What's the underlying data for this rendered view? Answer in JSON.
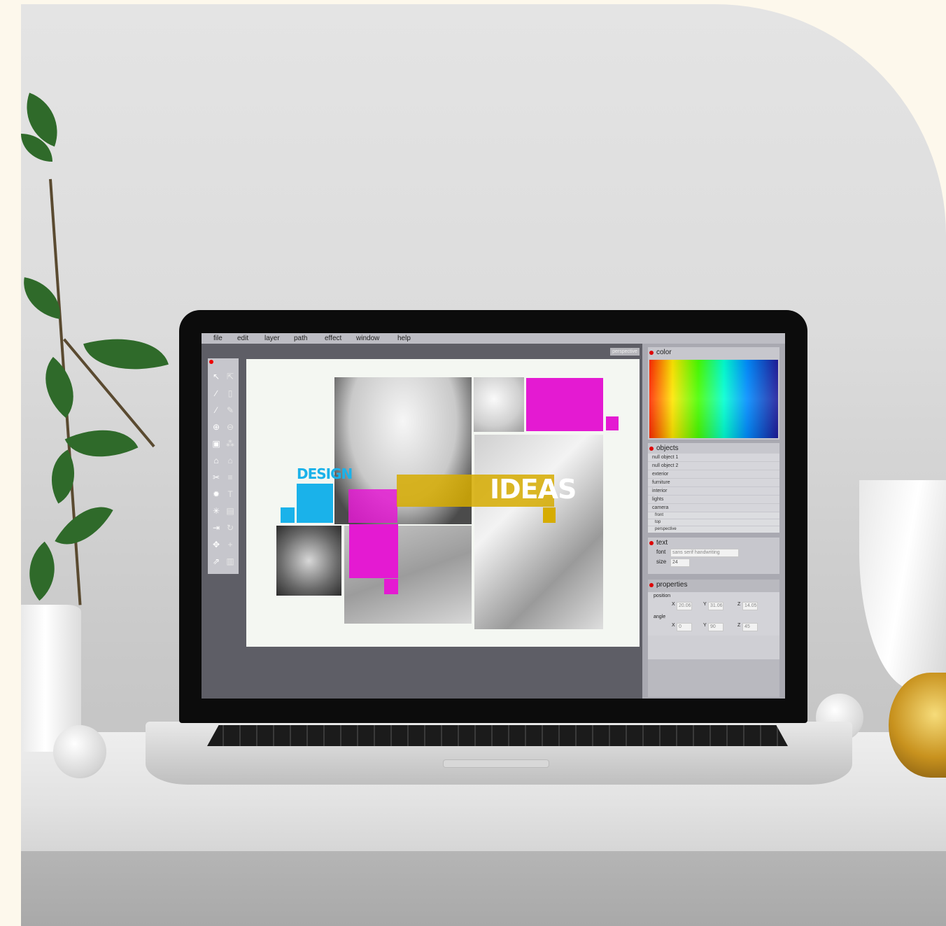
{
  "app": {
    "menu": [
      "file",
      "edit",
      "layer",
      "path",
      "effect",
      "window",
      "help"
    ],
    "view_tab": "perspective",
    "tools": [
      {
        "icon": "select-arrow-icon",
        "glyph": "↖"
      },
      {
        "icon": "direct-select-icon",
        "glyph": "⇱"
      },
      {
        "icon": "brush-icon",
        "glyph": "∕"
      },
      {
        "icon": "new-page-icon",
        "glyph": "▯"
      },
      {
        "icon": "eyedropper-icon",
        "glyph": "⁄"
      },
      {
        "icon": "pencil-icon",
        "glyph": "✎"
      },
      {
        "icon": "zoom-in-icon",
        "glyph": "⊕"
      },
      {
        "icon": "zoom-out-icon",
        "glyph": "⊖"
      },
      {
        "icon": "lock-icon",
        "glyph": "▣"
      },
      {
        "icon": "magic-wand-icon",
        "glyph": "⁂"
      },
      {
        "icon": "home-icon",
        "glyph": "⌂"
      },
      {
        "icon": "home-filled-icon",
        "glyph": "⌂"
      },
      {
        "icon": "scissors-icon",
        "glyph": "✂"
      },
      {
        "icon": "layers-icon",
        "glyph": "≡"
      },
      {
        "icon": "gear-icon",
        "glyph": "✹"
      },
      {
        "icon": "text-icon",
        "glyph": "T"
      },
      {
        "icon": "sparkle-icon",
        "glyph": "✳"
      },
      {
        "icon": "save-icon",
        "glyph": "▤"
      },
      {
        "icon": "export-icon",
        "glyph": "⇥"
      },
      {
        "icon": "rotate-icon",
        "glyph": "↻"
      },
      {
        "icon": "move-icon",
        "glyph": "✥"
      },
      {
        "icon": "crosshair-icon",
        "glyph": "+"
      },
      {
        "icon": "share-icon",
        "glyph": "⇗"
      },
      {
        "icon": "trash-icon",
        "glyph": "▥"
      }
    ],
    "panels": {
      "color": {
        "title": "color"
      },
      "objects": {
        "title": "objects",
        "items": [
          "null object 1",
          "null object 2",
          "exterior",
          "furniture",
          "interior",
          "lights",
          "camera"
        ],
        "camera_children": [
          "front",
          "top",
          "perspective"
        ]
      },
      "text": {
        "title": "text",
        "font_label": "font",
        "font_value": "sans serif handwriting",
        "size_label": "size",
        "size_value": "24"
      },
      "properties": {
        "title": "properties",
        "position_label": "position",
        "position": {
          "x": "20.06",
          "y": "31.06",
          "z": "14.05"
        },
        "angle_label": "angle",
        "angle": {
          "x": "0",
          "y": "90",
          "z": "45"
        },
        "x_label": "X",
        "y_label": "Y",
        "z_label": "Z"
      }
    },
    "canvas": {
      "word1": "DESIGN",
      "word2": "IDEAS"
    }
  },
  "colors": {
    "magenta": "#e41ad2",
    "cyan": "#1ab2ea",
    "yellow": "#d6ac00",
    "plant": "#2f6a2a"
  }
}
